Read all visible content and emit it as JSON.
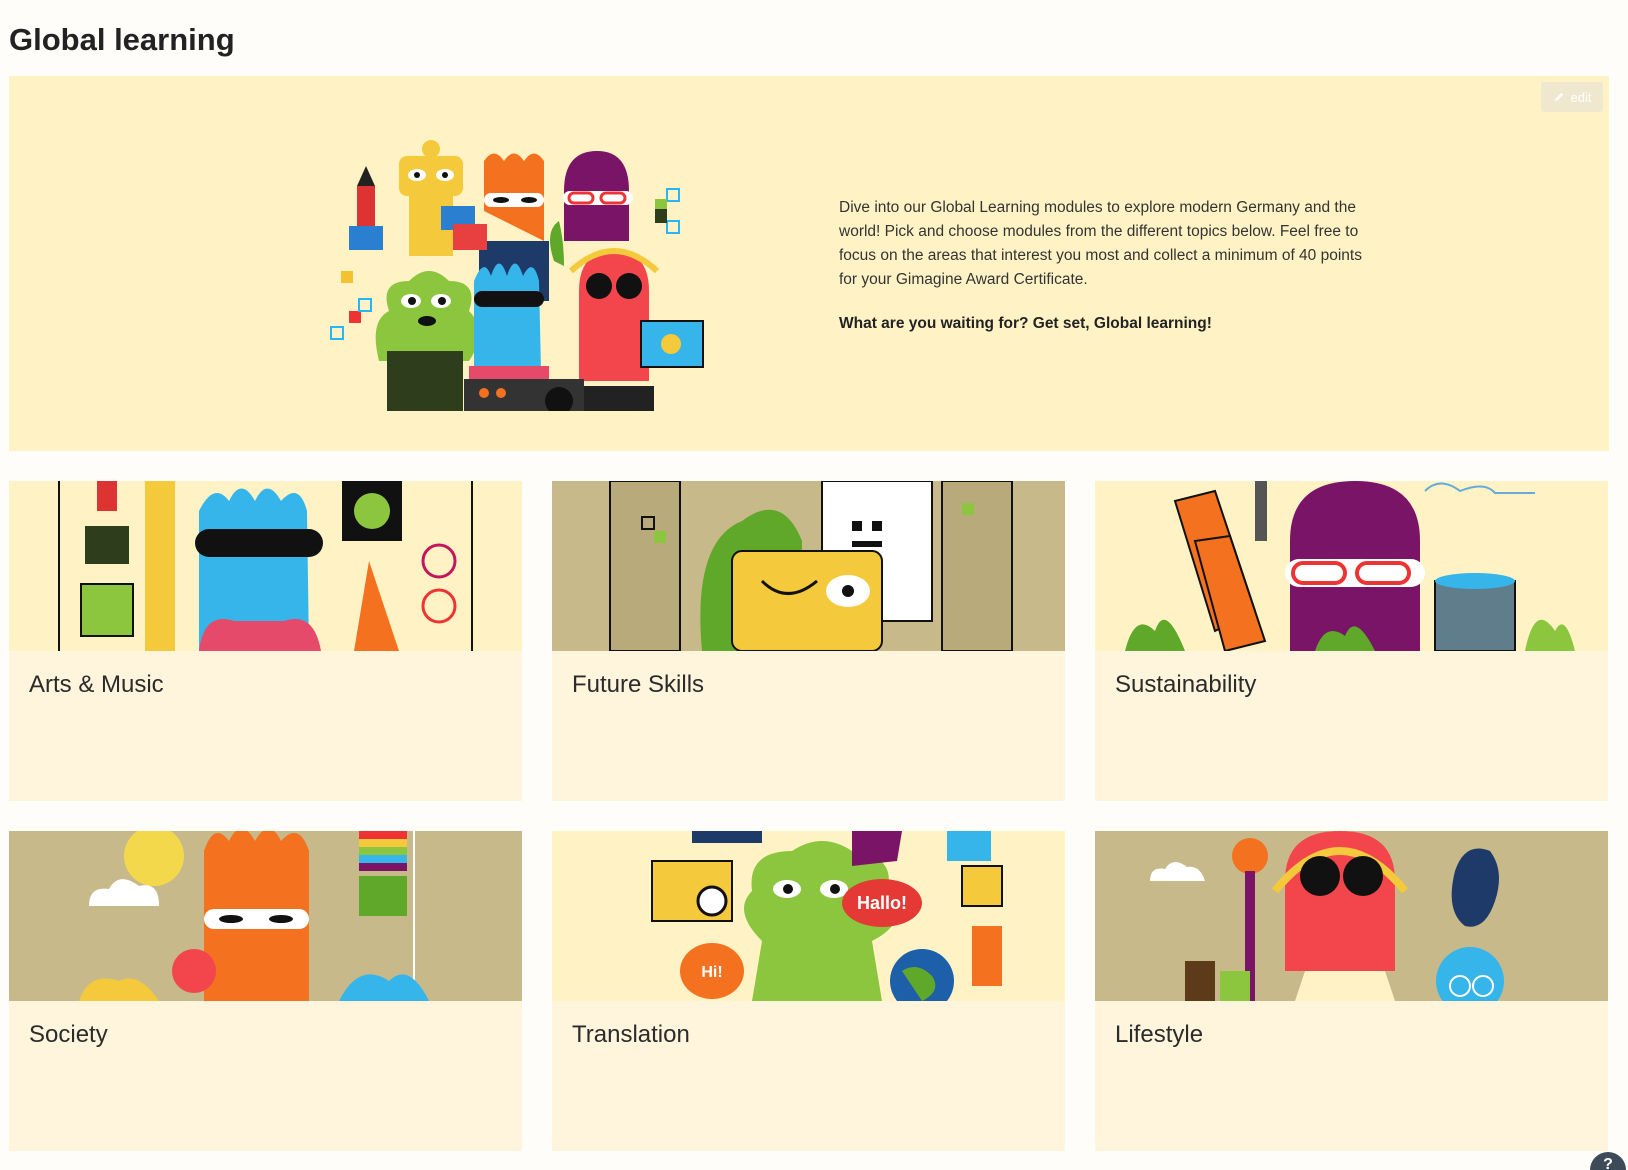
{
  "page": {
    "title": "Global learning"
  },
  "hero": {
    "edit_label": "edit",
    "description": "Dive into our Global Learning modules to explore modern Germany and the world! Pick and choose modules from the different topics below. Feel free to focus on the areas that interest you most and collect a minimum of 40 points for your Gimagine Award Certificate.",
    "cta": "What are you waiting for? Get set, Global learning!"
  },
  "topics": [
    {
      "label": "Arts & Music"
    },
    {
      "label": "Future Skills"
    },
    {
      "label": "Sustainability"
    },
    {
      "label": "Society"
    },
    {
      "label": "Translation"
    },
    {
      "label": "Lifestyle"
    }
  ],
  "help": {
    "label": "?"
  },
  "colors": {
    "hero_bg": "#fff3c6",
    "card_bg": "#fff5dd",
    "illustration_khaki": "#c8b98a",
    "illustration_cream": "#fff3c6"
  }
}
